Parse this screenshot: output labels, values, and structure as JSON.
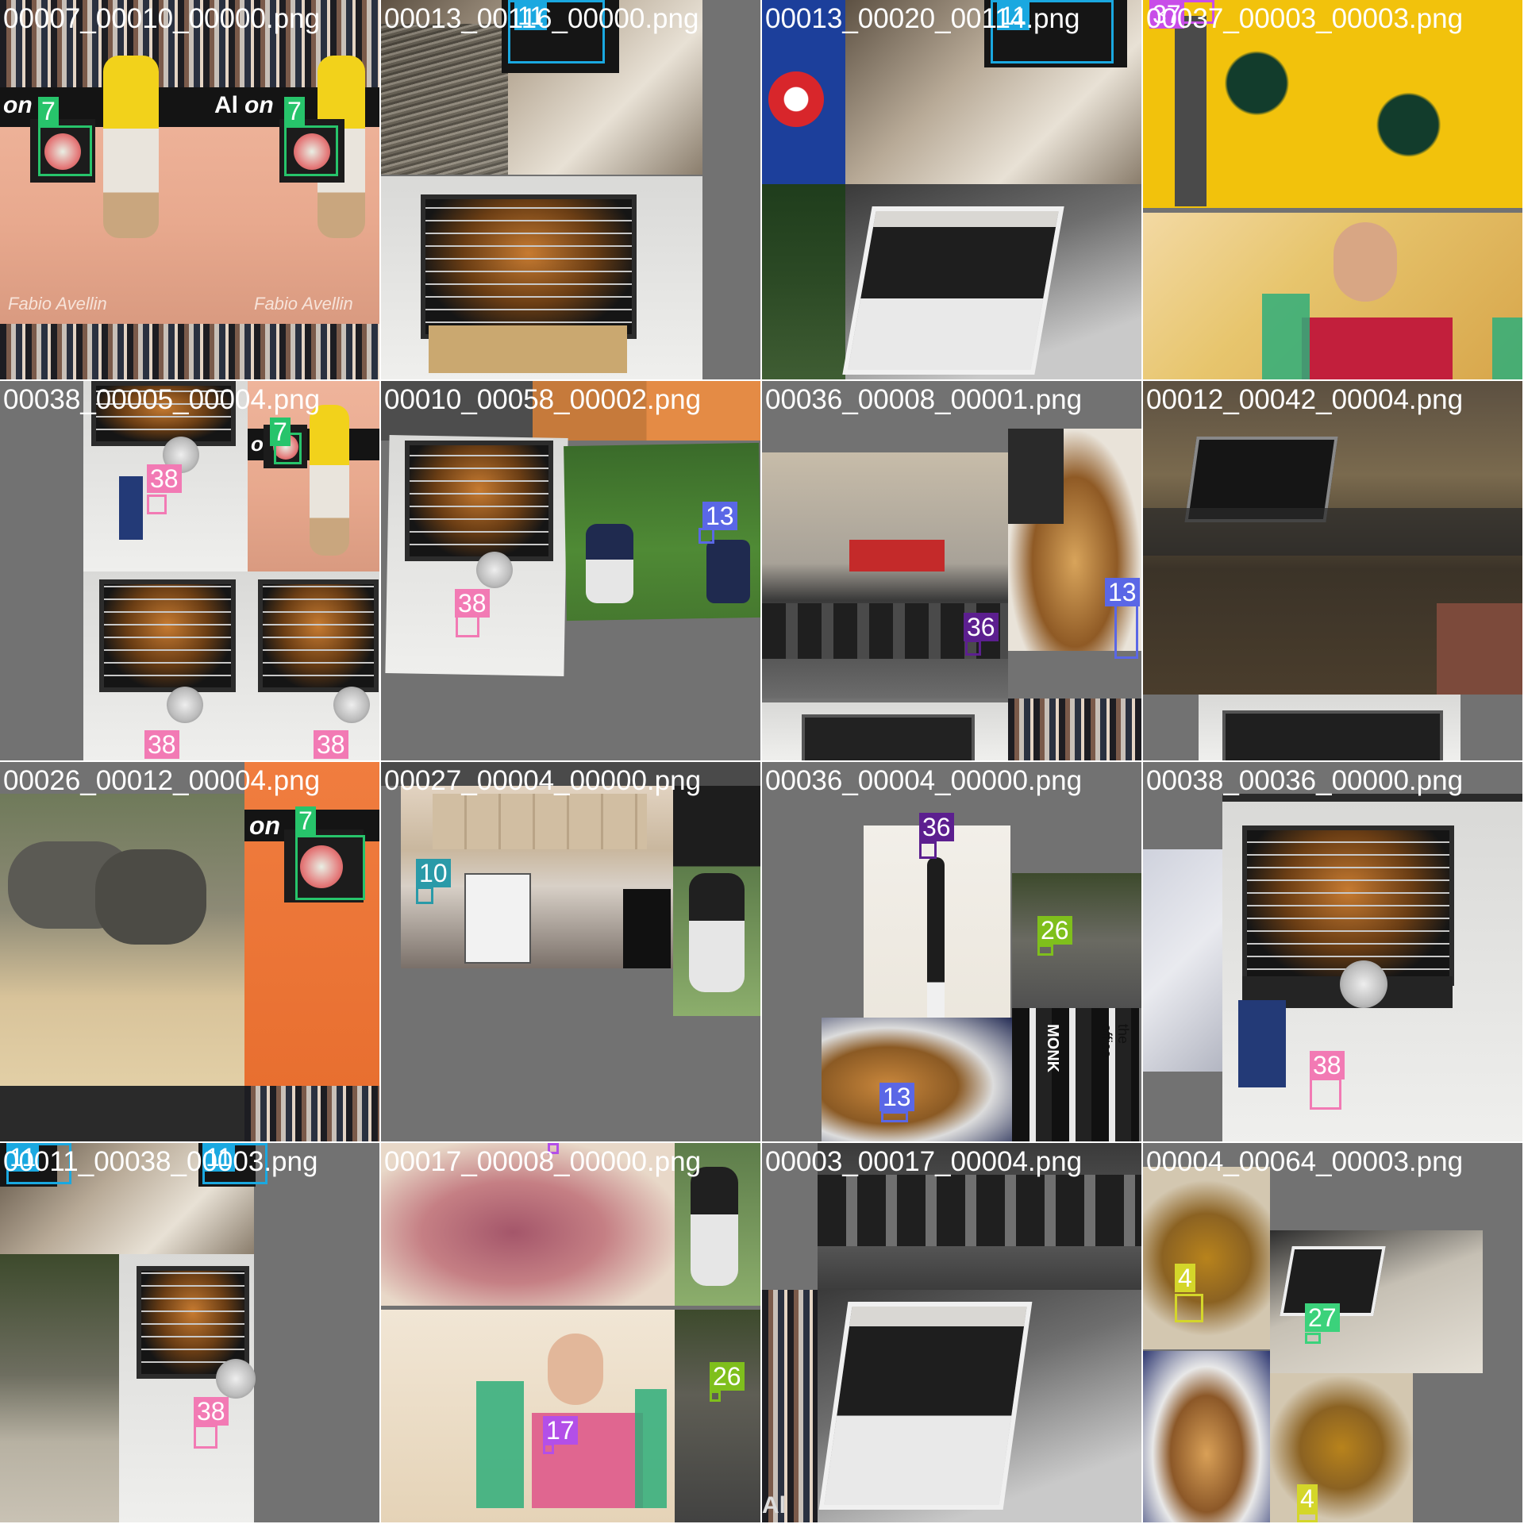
{
  "tiles": [
    {
      "filename": "00007_00010_00000.png",
      "labels": [
        "7",
        "7"
      ]
    },
    {
      "filename": "00013_00116_00000.png",
      "labels": [
        "11"
      ]
    },
    {
      "filename": "00013_00020_00114.png",
      "labels": [
        "11"
      ]
    },
    {
      "filename": "00037_00003_00003.png",
      "labels": [
        "37"
      ]
    },
    {
      "filename": "00038_00005_00004.png",
      "labels": [
        "7",
        "38",
        "38",
        "38"
      ]
    },
    {
      "filename": "00010_00058_00002.png",
      "labels": [
        "13",
        "38"
      ]
    },
    {
      "filename": "00036_00008_00001.png",
      "labels": [
        "13",
        "36"
      ]
    },
    {
      "filename": "00012_00042_00004.png",
      "labels": []
    },
    {
      "filename": "00026_00012_00004.png",
      "labels": [
        "7"
      ]
    },
    {
      "filename": "00027_00004_00000.png",
      "labels": [
        "10"
      ]
    },
    {
      "filename": "00036_00004_00000.png",
      "labels": [
        "36",
        "26",
        "13"
      ]
    },
    {
      "filename": "00038_00036_00000.png",
      "labels": [
        "38"
      ]
    },
    {
      "filename": "00011_00038_00003.png",
      "labels": [
        "11",
        "11",
        "38"
      ]
    },
    {
      "filename": "00017_00008_00000.png",
      "labels": [
        "17",
        "17",
        "26"
      ]
    },
    {
      "filename": "00003_00017_00004.png",
      "labels": []
    },
    {
      "filename": "00004_00064_00003.png",
      "labels": [
        "4",
        "27",
        "4"
      ]
    }
  ],
  "class_colors": {
    "4": "#d4d62a",
    "7": "#27c46b",
    "10": "#2a9aa8",
    "11": "#1aa8e0",
    "13": "#5a67e6",
    "17": "#b34fe8",
    "26": "#7fbf1c",
    "27": "#3bd27b",
    "36": "#5c1f8f",
    "37": "#c84de8",
    "38": "#f27ab4"
  },
  "image_text": {
    "banner_left": "on",
    "banner_mid": "Al",
    "watermark": "Fabio Avellin",
    "book_text": "MONK",
    "book_side": "the office"
  }
}
